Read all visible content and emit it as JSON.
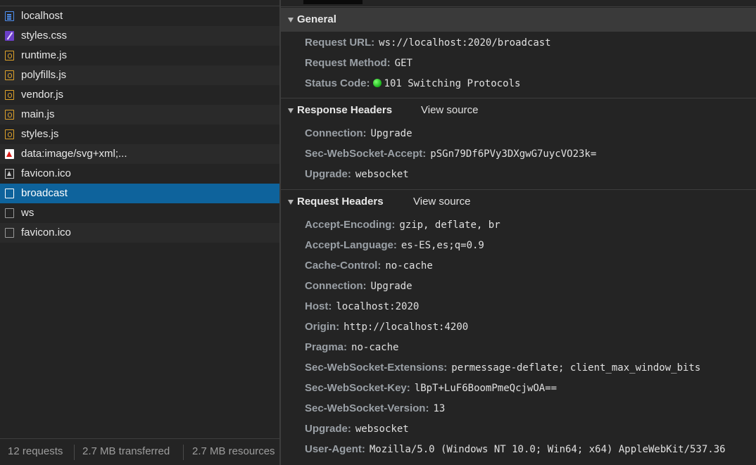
{
  "requests": [
    {
      "name": "localhost",
      "icon": "document-icon"
    },
    {
      "name": "styles.css",
      "icon": "stylesheet-icon"
    },
    {
      "name": "runtime.js",
      "icon": "script-icon"
    },
    {
      "name": "polyfills.js",
      "icon": "script-icon"
    },
    {
      "name": "vendor.js",
      "icon": "script-icon"
    },
    {
      "name": "main.js",
      "icon": "script-icon"
    },
    {
      "name": "styles.js",
      "icon": "script-icon"
    },
    {
      "name": "data:image/svg+xml;...",
      "icon": "svg-image-icon"
    },
    {
      "name": "favicon.ico",
      "icon": "image-icon"
    },
    {
      "name": "broadcast",
      "icon": "websocket-icon",
      "selected": true
    },
    {
      "name": "ws",
      "icon": "websocket-icon"
    },
    {
      "name": "favicon.ico",
      "icon": "websocket-icon"
    }
  ],
  "status": {
    "requests": "12 requests",
    "transferred": "2.7 MB transferred",
    "resources": "2.7 MB resources"
  },
  "general": {
    "title": "General",
    "rows": [
      {
        "key": "Request URL:",
        "value": "ws://localhost:2020/broadcast"
      },
      {
        "key": "Request Method:",
        "value": "GET"
      },
      {
        "key": "Status Code:",
        "value": "101 Switching Protocols",
        "status_color": "#18b21a"
      }
    ]
  },
  "response_headers": {
    "title": "Response Headers",
    "view_source": "View source",
    "rows": [
      {
        "key": "Connection:",
        "value": "Upgrade"
      },
      {
        "key": "Sec-WebSocket-Accept:",
        "value": "pSGn79Df6PVy3DXgwG7uycVO23k="
      },
      {
        "key": "Upgrade:",
        "value": "websocket"
      }
    ]
  },
  "request_headers": {
    "title": "Request Headers",
    "view_source": "View source",
    "rows": [
      {
        "key": "Accept-Encoding:",
        "value": "gzip, deflate, br"
      },
      {
        "key": "Accept-Language:",
        "value": "es-ES,es;q=0.9"
      },
      {
        "key": "Cache-Control:",
        "value": "no-cache"
      },
      {
        "key": "Connection:",
        "value": "Upgrade"
      },
      {
        "key": "Host:",
        "value": "localhost:2020"
      },
      {
        "key": "Origin:",
        "value": "http://localhost:4200"
      },
      {
        "key": "Pragma:",
        "value": "no-cache"
      },
      {
        "key": "Sec-WebSocket-Extensions:",
        "value": "permessage-deflate; client_max_window_bits"
      },
      {
        "key": "Sec-WebSocket-Key:",
        "value": "lBpT+LuF6BoomPmeQcjwOA=="
      },
      {
        "key": "Sec-WebSocket-Version:",
        "value": "13"
      },
      {
        "key": "Upgrade:",
        "value": "websocket"
      },
      {
        "key": "User-Agent:",
        "value": "Mozilla/5.0 (Windows NT 10.0; Win64; x64) AppleWebKit/537.36"
      }
    ]
  },
  "colors": {
    "selected_row": "#0e639c",
    "background": "#242424",
    "section_header": "#3a3a3a"
  }
}
